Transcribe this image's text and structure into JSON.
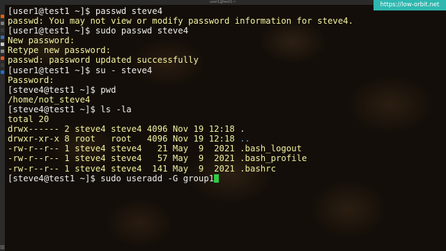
{
  "window": {
    "title": "user1@test1:~"
  },
  "watermark": "https://low-orbit.net",
  "dock": {
    "icons": [
      {
        "name": "browser-icon",
        "color": "#e66100"
      },
      {
        "name": "files-icon",
        "color": "#7f7f7f"
      },
      {
        "name": "terminal-icon",
        "color": "#3c3c3c"
      },
      {
        "name": "mail-icon",
        "color": "#3b6fb6"
      },
      {
        "name": "text-editor-icon",
        "color": "#cfcfcf"
      },
      {
        "name": "settings-icon",
        "color": "#8a8a8a"
      },
      {
        "name": "software-icon",
        "color": "#e95420"
      },
      {
        "name": "terminal-icon",
        "color": "#3c3c3c"
      },
      {
        "name": "help-icon",
        "color": "#1c71d8"
      }
    ]
  },
  "terminal": {
    "lines": [
      {
        "prompt": "[user1@test1 ~]$ ",
        "cmd": "passwd steve4"
      },
      {
        "out": "passwd: You may not view or modify password information for steve4."
      },
      {
        "prompt": "[user1@test1 ~]$ ",
        "cmd": "sudo passwd steve4"
      },
      {
        "out": "New password:"
      },
      {
        "out": "Retype new password:"
      },
      {
        "out": "passwd: password updated successfully"
      },
      {
        "prompt": "[user1@test1 ~]$ ",
        "cmd": "su - steve4"
      },
      {
        "out": "Password:"
      },
      {
        "prompt": "[steve4@test1 ~]$ ",
        "cmd": "pwd"
      },
      {
        "out": "/home/not_steve4"
      },
      {
        "prompt": "[steve4@test1 ~]$ ",
        "cmd": "ls -la"
      },
      {
        "out": "total 20"
      },
      {
        "out": "drwx------ 2 steve4 steve4 4096 Nov 19 12:18 ",
        "name": ".",
        "name_style": "dir1"
      },
      {
        "out": "drwxr-xr-x 8 root   root   4096 Nov 19 12:18 ",
        "name": "..",
        "name_style": "dir2"
      },
      {
        "out": "-rw-r--r-- 1 steve4 steve4   21 May  9  2021 .bash_logout"
      },
      {
        "out": "-rw-r--r-- 1 steve4 steve4   57 May  9  2021 .bash_profile"
      },
      {
        "out": "-rw-r--r-- 1 steve4 steve4  141 May  9  2021 .bashrc"
      },
      {
        "prompt": "[steve4@test1 ~]$ ",
        "cmd": "sudo useradd -G group1",
        "cursor": true
      }
    ]
  },
  "colors": {
    "output_text": "#f2f2a0",
    "prompt_text": "#eeeeec",
    "cursor": "#2ecc40",
    "watermark_bg": "#2fb8b0"
  }
}
